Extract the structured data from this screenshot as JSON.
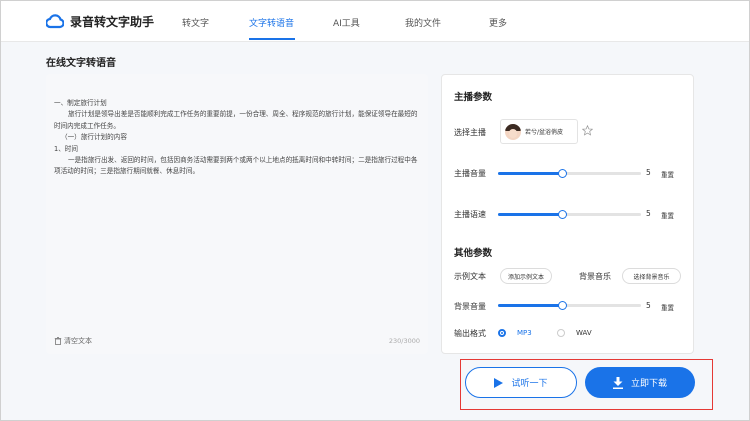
{
  "header": {
    "app_name": "录音转文字助手",
    "nav": [
      "转文字",
      "文字转语音",
      "AI工具",
      "我的文件",
      "更多"
    ],
    "active_nav": "文字转语音"
  },
  "page_title": "在线文字转语音",
  "editor": {
    "paragraphs": [
      "一、制定旅行计划",
      "旅行计划是领导出差是否能顺利完成工作任务的重要前提，一份合理、周全、程序规范的旅行计划，能保证领导在最短的时间内完成工作任务。",
      "（一）旅行计划的内容",
      "1、时间",
      "一是指旅行出发、返回的时间，包括因商务活动需要到两个或两个以上地点的抵离时间和中转时间；二是指旅行过程中各项活动的时间；三是指旅行期间就餐、休息时间。"
    ],
    "clear_label": "清空文本",
    "char_count": "230/3000"
  },
  "settings": {
    "anchor_section_title": "主播参数",
    "select_anchor_label": "选择主播",
    "anchor_name": "若兮/盆浴俏皮",
    "volume_label": "主播音量",
    "volume_value": "5",
    "volume_level": 0.45,
    "speed_label": "主播语速",
    "speed_value": "5",
    "speed_level": 0.45,
    "reset_label": "重置",
    "other_section_title": "其他参数",
    "sample_text_label": "示例文本",
    "add_sample_button": "添加示例文本",
    "bg_music_label": "背景音乐",
    "select_bg_music_button": "选择背景音乐",
    "bg_volume_label": "背景音量",
    "bg_volume_value": "5",
    "bg_volume_level": 0.45,
    "output_format_label": "输出格式",
    "format_options": [
      "MP3",
      "WAV"
    ],
    "selected_format": "MP3"
  },
  "actions": {
    "listen_label": "试听一下",
    "download_label": "立即下载"
  },
  "colors": {
    "accent": "#1a73e8",
    "highlight_box": "#e53935"
  }
}
